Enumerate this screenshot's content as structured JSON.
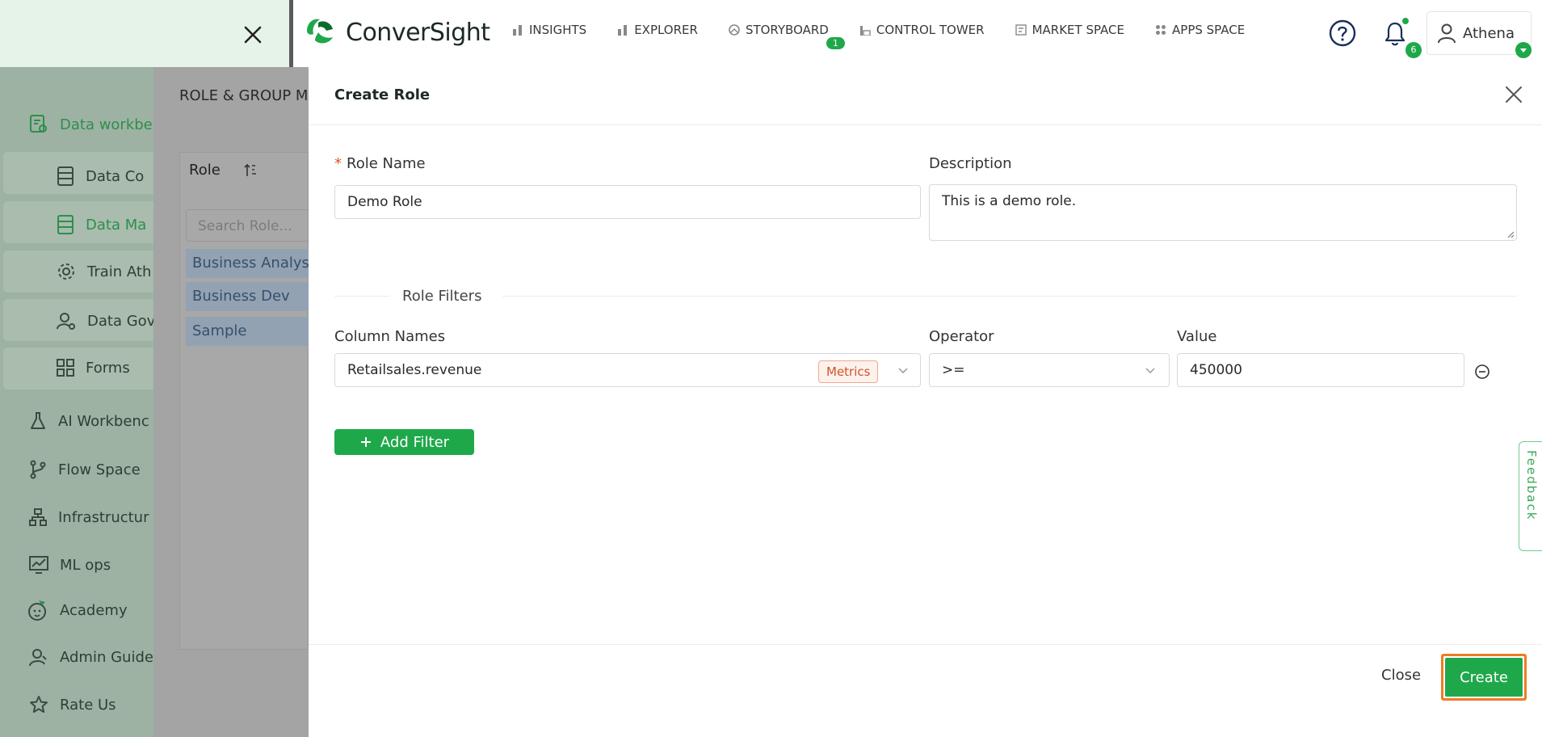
{
  "topbar": {
    "brand": "ConverSight",
    "nav": [
      {
        "label": "INSIGHTS",
        "icon": "bar-chart-icon"
      },
      {
        "label": "EXPLORER",
        "icon": "bar-chart-icon"
      },
      {
        "label": "STORYBOARD",
        "icon": "storyboard-icon",
        "badge": "1"
      },
      {
        "label": "CONTROL TOWER",
        "icon": "control-tower-icon"
      },
      {
        "label": "MARKET SPACE",
        "icon": "market-space-icon"
      },
      {
        "label": "APPS SPACE",
        "icon": "apps-grid-icon"
      }
    ],
    "notifications_count": "6",
    "user_name": "Athena"
  },
  "sidebar": {
    "items": [
      {
        "label": "Data workbe",
        "icon": "data-workbench-icon"
      },
      {
        "label": "Data Co",
        "icon": "database-icon"
      },
      {
        "label": "Data Ma",
        "icon": "database-icon"
      },
      {
        "label": "Train Ath",
        "icon": "gear-icon"
      },
      {
        "label": "Data Gov",
        "icon": "user-gear-icon"
      },
      {
        "label": "Forms",
        "icon": "grid-icon"
      },
      {
        "label": "AI Workbenc",
        "icon": "flask-icon"
      },
      {
        "label": "Flow Space",
        "icon": "branch-icon"
      },
      {
        "label": "Infrastructur",
        "icon": "hierarchy-icon"
      },
      {
        "label": "ML ops",
        "icon": "chart-line-icon"
      },
      {
        "label": "Academy",
        "icon": "academy-icon"
      },
      {
        "label": "Admin Guide",
        "icon": "admin-icon"
      },
      {
        "label": "Rate Us",
        "icon": "star-icon"
      }
    ]
  },
  "role_panel": {
    "title": "ROLE & GROUP M",
    "column_header": "Role",
    "search_placeholder": "Search Role...",
    "roles": [
      "Business Analys",
      "Business Dev",
      "Sample"
    ]
  },
  "drawer": {
    "title": "Create Role",
    "role_name_label": "Role Name",
    "role_name_value": "Demo Role",
    "description_label": "Description",
    "description_value": "This is a demo role.",
    "filters_title": "Role Filters",
    "column_names_label": "Column Names",
    "operator_label": "Operator",
    "value_label": "Value",
    "filter": {
      "column": "Retailsales.revenue",
      "tag": "Metrics",
      "operator": ">=",
      "value": "450000"
    },
    "add_filter_label": "Add Filter",
    "close_label": "Close",
    "create_label": "Create"
  },
  "feedback_label": "Feedback",
  "colors": {
    "brand_green": "#1fa84a",
    "highlight_orange": "#f07b23",
    "tag_orange": "#d1532a"
  }
}
